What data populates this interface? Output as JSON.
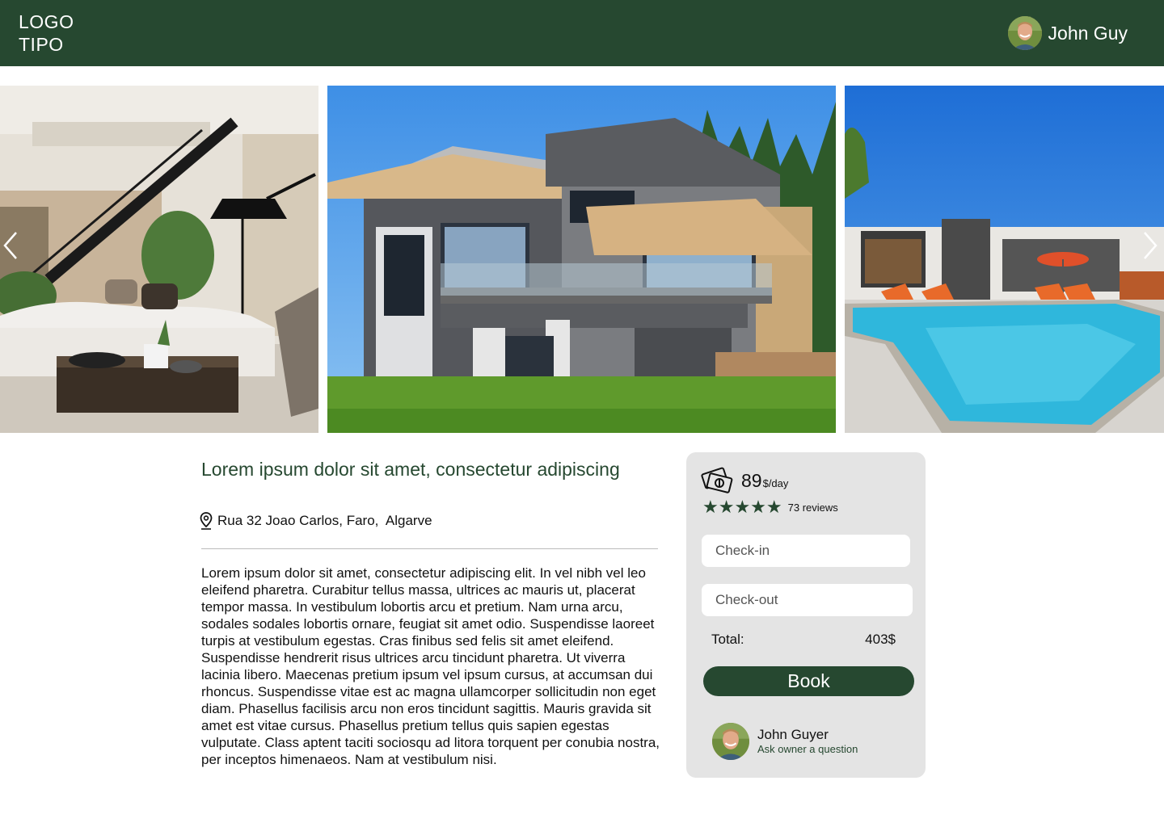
{
  "header": {
    "logo_line1": "LOGO",
    "logo_line2": "TIPO",
    "user_name": "John Guy"
  },
  "gallery": {
    "photos": [
      {
        "name": "living-room-photo"
      },
      {
        "name": "house-exterior-photo"
      },
      {
        "name": "pool-photo"
      }
    ],
    "prev_icon": "chevron-left-icon",
    "next_icon": "chevron-right-icon"
  },
  "listing": {
    "title": "Lorem ipsum dolor sit amet, consectetur adipiscing",
    "address": "Rua 32 Joao Carlos, Faro,  Algarve",
    "description": "Lorem ipsum dolor sit amet, consectetur adipiscing elit. In vel nibh vel leo eleifend pharetra. Curabitur tellus massa, ultrices ac mauris ut, placerat tempor massa. In vestibulum lobortis arcu et pretium. Nam urna arcu, sodales sodales lobortis ornare, feugiat sit amet odio. Suspendisse laoreet turpis at vestibulum egestas. Cras finibus sed felis sit amet eleifend. Suspendisse hendrerit risus ultrices arcu tincidunt pharetra. Ut viverra lacinia libero. Maecenas pretium ipsum vel ipsum cursus, at accumsan dui rhoncus. Suspendisse vitae est ac magna ullamcorper sollicitudin non eget diam. Phasellus facilisis arcu non eros tincidunt sagittis. Mauris gravida sit amet est vitae cursus. Phasellus pretium tellus quis sapien egestas vulputate. Class aptent taciti sociosqu ad litora torquent per conubia nostra, per inceptos himenaeos. Nam at vestibulum nisi."
  },
  "booking": {
    "price": "89",
    "price_unit": "$/day",
    "rating": 5,
    "stars": "★★★★★",
    "reviews": "73 reviews",
    "checkin_placeholder": "Check-in",
    "checkout_placeholder": "Check-out",
    "total_label": "Total:",
    "total_value": "403$",
    "book_label": "Book",
    "owner_name": "John Guyer",
    "owner_link": "Ask owner a question"
  },
  "colors": {
    "primary": "#264830",
    "card_bg": "#e4e4e4"
  }
}
